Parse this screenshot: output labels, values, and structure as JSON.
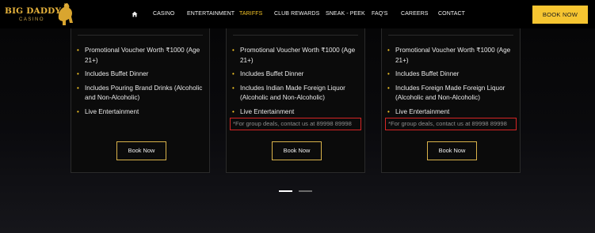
{
  "brand": {
    "name": "BIG DADDY",
    "subtitle": "CASINO",
    "accent_color": "#f5c527",
    "logo_icon": "lion-icon"
  },
  "nav": {
    "home_icon": "home-icon",
    "items": [
      {
        "label": "CASINO",
        "active": false
      },
      {
        "label": "ENTERTAINMENT",
        "active": false
      },
      {
        "label": "TARIFFS",
        "active": true
      },
      {
        "label": "CLUB REWARDS",
        "active": false
      },
      {
        "label": "SNEAK - PEEK",
        "active": false
      },
      {
        "label": "FAQ'S",
        "active": false
      },
      {
        "label": "CAREERS",
        "active": false
      },
      {
        "label": "CONTACT",
        "active": false
      }
    ],
    "book_now_label": "BOOK NOW"
  },
  "packages": [
    {
      "features": [
        "Promotional Voucher Worth ₹1000 (Age 21+)",
        "Includes Buffet Dinner",
        "Includes Pouring Brand Drinks (Alcoholic and Non-Alcoholic)",
        "Live Entertainment"
      ],
      "note": "",
      "button_label": "Book Now"
    },
    {
      "features": [
        "Promotional Voucher Worth ₹1000 (Age 21+)",
        "Includes Buffet Dinner",
        "Includes Indian Made Foreign Liquor (Alcoholic and Non-Alcoholic)",
        "Live Entertainment"
      ],
      "note": "*For group deals, contact us at 89998 89998",
      "button_label": "Book Now"
    },
    {
      "features": [
        "Promotional Voucher Worth ₹1000 (Age 21+)",
        "Includes Buffet Dinner",
        "Includes Foreign Made Foreign Liquor (Alcoholic and Non-Alcoholic)",
        "Live Entertainment"
      ],
      "note": "*For group deals, contact us at 89998 89998",
      "button_label": "Book Now"
    }
  ],
  "carousel": {
    "total_slides": 2,
    "active_slide": 1,
    "active_color": "#ffffff",
    "inactive_color": "#6b6b6b"
  },
  "colors": {
    "note_highlight": "#d52525",
    "button_border": "#d9b24a",
    "header_button_bg": "#f6c531"
  }
}
